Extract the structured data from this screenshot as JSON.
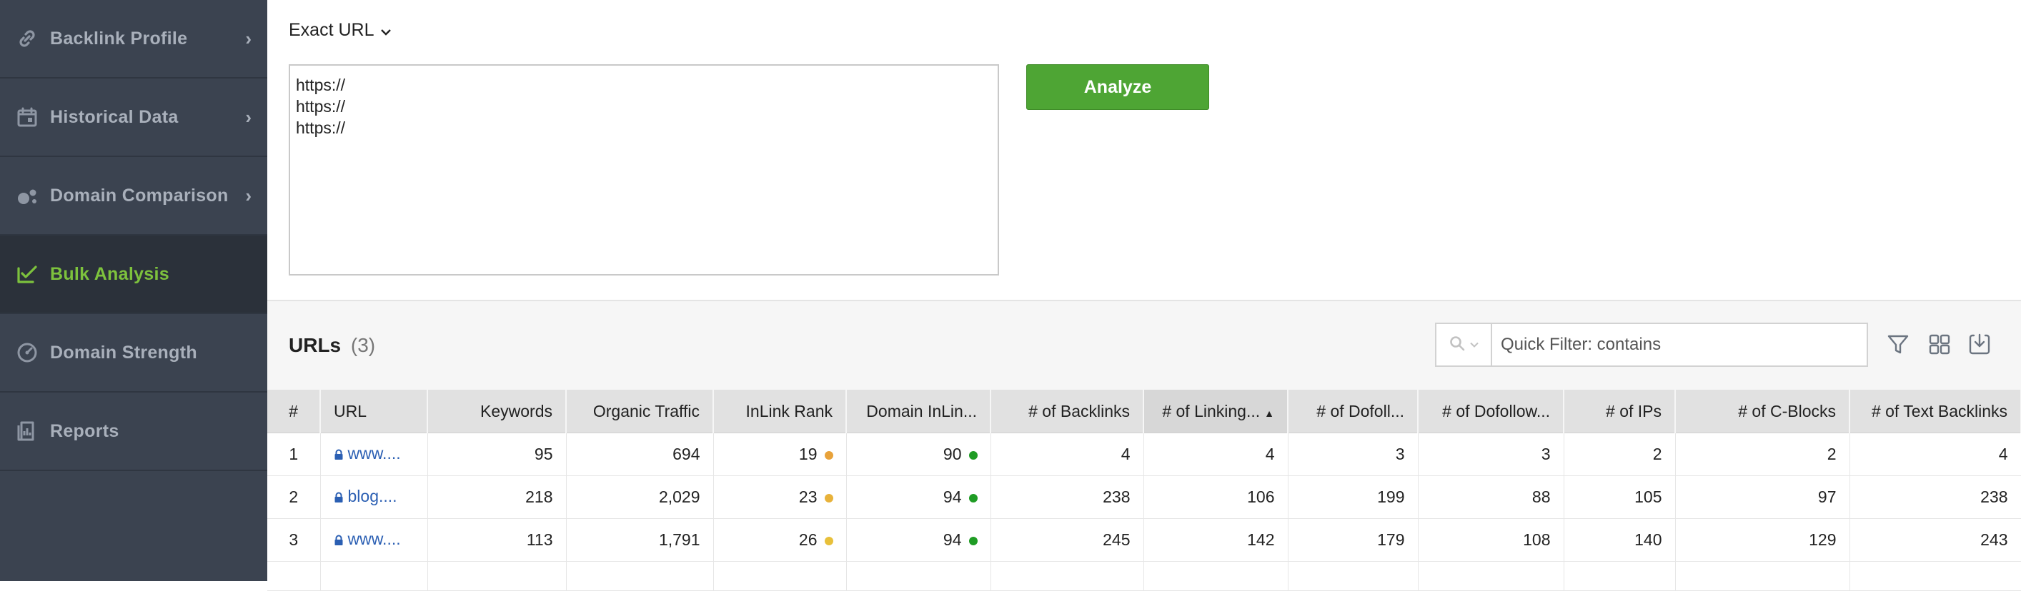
{
  "sidebar": {
    "items": [
      {
        "label": "Backlink Profile",
        "icon": "link-icon",
        "chevron": "›",
        "active": false
      },
      {
        "label": "Historical Data",
        "icon": "calendar-icon",
        "chevron": "›",
        "active": false
      },
      {
        "label": "Domain Comparison",
        "icon": "circles-icon",
        "chevron": "›",
        "active": false
      },
      {
        "label": "Bulk Analysis",
        "icon": "checklist-icon",
        "chevron": "",
        "active": true
      },
      {
        "label": "Domain Strength",
        "icon": "gauge-icon",
        "chevron": "",
        "active": false
      },
      {
        "label": "Reports",
        "icon": "report-icon",
        "chevron": "",
        "active": false
      }
    ]
  },
  "top": {
    "mode_label": "Exact URL",
    "textarea_lines": [
      "https://",
      "https://",
      "https://"
    ],
    "analyze_label": "Analyze"
  },
  "results": {
    "title": "URLs",
    "count": "(3)",
    "filter_placeholder": "Quick Filter: contains",
    "columns": [
      "#",
      "URL",
      "Keywords",
      "Organic Traffic",
      "InLink Rank",
      "Domain InLin...",
      "# of Backlinks",
      "# of Linking...",
      "# of Dofoll...",
      "# of Dofollow...",
      "# of IPs",
      "# of C-Blocks",
      "# of Text Backlinks"
    ],
    "sorted_column": "# of Linking...",
    "rows": [
      {
        "num": "1",
        "url": "www....",
        "keywords": "95",
        "organic_traffic": "694",
        "inlink_rank": "19",
        "inlink_rank_color": "#e8a23a",
        "domain_inlink": "90",
        "domain_inlink_color": "#1f9c24",
        "backlinks": "4",
        "linking": "4",
        "dofoll": "3",
        "dofollow": "3",
        "ips": "2",
        "cblocks": "2",
        "text_backlinks": "4"
      },
      {
        "num": "2",
        "url": "blog....",
        "keywords": "218",
        "organic_traffic": "2,029",
        "inlink_rank": "23",
        "inlink_rank_color": "#e8b23a",
        "domain_inlink": "94",
        "domain_inlink_color": "#1f9c24",
        "backlinks": "238",
        "linking": "106",
        "dofoll": "199",
        "dofollow": "88",
        "ips": "105",
        "cblocks": "97",
        "text_backlinks": "238"
      },
      {
        "num": "3",
        "url": "www....",
        "keywords": "113",
        "organic_traffic": "1,791",
        "inlink_rank": "26",
        "inlink_rank_color": "#e8c03a",
        "domain_inlink": "94",
        "domain_inlink_color": "#1f9c24",
        "backlinks": "245",
        "linking": "142",
        "dofoll": "179",
        "dofollow": "108",
        "ips": "140",
        "cblocks": "129",
        "text_backlinks": "243"
      }
    ]
  },
  "colors": {
    "sidebar_bg": "#3b4350",
    "active_accent": "#7dc23d",
    "analyze_green": "#4ea534",
    "link_blue": "#2b5fb3"
  }
}
